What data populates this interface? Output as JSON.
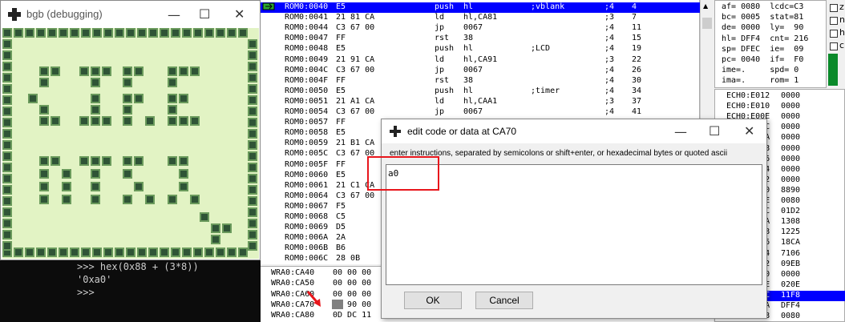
{
  "bgb": {
    "title": "bgb (debugging)",
    "minimize": "—",
    "maximize": "☐",
    "close": "✕"
  },
  "console": {
    "lines": [
      ">>> hex(0x88 + (3*8))",
      "'0xa0'",
      ">>>"
    ]
  },
  "disassembly": [
    {
      "addr": "ROM0:0040",
      "bytes": "E5",
      "mnem": "push",
      "ops": "hl",
      "comment": ";vblank",
      "cyc": ";4",
      "total": "4",
      "selected": true
    },
    {
      "addr": "ROM0:0041",
      "bytes": "21 81 CA",
      "mnem": "ld",
      "ops": "hl,CA81",
      "comment": "",
      "cyc": ";3",
      "total": "7"
    },
    {
      "addr": "ROM0:0044",
      "bytes": "C3 67 00",
      "mnem": "jp",
      "ops": "0067",
      "comment": "",
      "cyc": ";4",
      "total": "11"
    },
    {
      "addr": "ROM0:0047",
      "bytes": "FF",
      "mnem": "rst",
      "ops": "38",
      "comment": "",
      "cyc": ";4",
      "total": "15"
    },
    {
      "addr": "ROM0:0048",
      "bytes": "E5",
      "mnem": "push",
      "ops": "hl",
      "comment": ";LCD",
      "cyc": ";4",
      "total": "19"
    },
    {
      "addr": "ROM0:0049",
      "bytes": "21 91 CA",
      "mnem": "ld",
      "ops": "hl,CA91",
      "comment": "",
      "cyc": ";3",
      "total": "22"
    },
    {
      "addr": "ROM0:004C",
      "bytes": "C3 67 00",
      "mnem": "jp",
      "ops": "0067",
      "comment": "",
      "cyc": ";4",
      "total": "26"
    },
    {
      "addr": "ROM0:004F",
      "bytes": "FF",
      "mnem": "rst",
      "ops": "38",
      "comment": "",
      "cyc": ";4",
      "total": "30"
    },
    {
      "addr": "ROM0:0050",
      "bytes": "E5",
      "mnem": "push",
      "ops": "hl",
      "comment": ";timer",
      "cyc": ";4",
      "total": "34"
    },
    {
      "addr": "ROM0:0051",
      "bytes": "21 A1 CA",
      "mnem": "ld",
      "ops": "hl,CAA1",
      "comment": "",
      "cyc": ";3",
      "total": "37"
    },
    {
      "addr": "ROM0:0054",
      "bytes": "C3 67 00",
      "mnem": "jp",
      "ops": "0067",
      "comment": "",
      "cyc": ";4",
      "total": "41"
    },
    {
      "addr": "ROM0:0057",
      "bytes": "FF",
      "mnem": "",
      "ops": "",
      "comment": "",
      "cyc": "",
      "total": ""
    },
    {
      "addr": "ROM0:0058",
      "bytes": "E5",
      "mnem": "",
      "ops": "",
      "comment": "",
      "cyc": "",
      "total": ""
    },
    {
      "addr": "ROM0:0059",
      "bytes": "21 B1 CA",
      "mnem": "",
      "ops": "",
      "comment": "",
      "cyc": "",
      "total": ""
    },
    {
      "addr": "ROM0:005C",
      "bytes": "C3 67 00",
      "mnem": "",
      "ops": "",
      "comment": "",
      "cyc": "",
      "total": ""
    },
    {
      "addr": "ROM0:005F",
      "bytes": "FF",
      "mnem": "",
      "ops": "",
      "comment": "",
      "cyc": "",
      "total": ""
    },
    {
      "addr": "ROM0:0060",
      "bytes": "E5",
      "mnem": "",
      "ops": "",
      "comment": "",
      "cyc": "",
      "total": ""
    },
    {
      "addr": "ROM0:0061",
      "bytes": "21 C1 CA",
      "mnem": "",
      "ops": "",
      "comment": "",
      "cyc": "",
      "total": ""
    },
    {
      "addr": "ROM0:0064",
      "bytes": "C3 67 00",
      "mnem": "",
      "ops": "",
      "comment": "",
      "cyc": "",
      "total": ""
    },
    {
      "addr": "ROM0:0067",
      "bytes": "F5",
      "mnem": "",
      "ops": "",
      "comment": "",
      "cyc": "",
      "total": ""
    },
    {
      "addr": "ROM0:0068",
      "bytes": "C5",
      "mnem": "",
      "ops": "",
      "comment": "",
      "cyc": "",
      "total": ""
    },
    {
      "addr": "ROM0:0069",
      "bytes": "D5",
      "mnem": "",
      "ops": "",
      "comment": "",
      "cyc": "",
      "total": ""
    },
    {
      "addr": "ROM0:006A",
      "bytes": "2A",
      "mnem": "",
      "ops": "",
      "comment": "",
      "cyc": "",
      "total": ""
    },
    {
      "addr": "ROM0:006B",
      "bytes": "B6",
      "mnem": "",
      "ops": "",
      "comment": "",
      "cyc": "",
      "total": ""
    },
    {
      "addr": "ROM0:006C",
      "bytes": "28 0B",
      "mnem": "",
      "ops": "",
      "comment": "",
      "cyc": "",
      "total": ""
    }
  ],
  "registers": [
    "af= 0080  lcdc=C3",
    "bc= 0005  stat=81",
    "de= 0000  ly=  90",
    "hl= DFF4  cnt= 216",
    "sp= DFEC  ie=  09",
    "pc= 0040  if=  F0",
    "ime=.     spd= 0",
    "ima=.     rom= 1"
  ],
  "flags": [
    "z",
    "n",
    "h",
    "c"
  ],
  "stack": [
    {
      "addr": "ECH0:E012",
      "val": "0000"
    },
    {
      "addr": "ECH0:E010",
      "val": "0000"
    },
    {
      "addr": "ECH0:E00E",
      "val": "0000"
    },
    {
      "addr": "ECH0:E00C",
      "val": "0000"
    },
    {
      "addr": "ECH0:E00A",
      "val": "0000"
    },
    {
      "addr": "ECH0:E008",
      "val": "0000"
    },
    {
      "addr": "ECH0:E006",
      "val": "0000"
    },
    {
      "addr": "ECH0:E004",
      "val": "0000"
    },
    {
      "addr": "ECH0:E002",
      "val": "0000"
    },
    {
      "addr": "ECH0:E000",
      "val": "8890"
    },
    {
      "addr": "WRA1:DFFE",
      "val": "0080"
    },
    {
      "addr": "WRA1:DFFC",
      "val": "01D2"
    },
    {
      "addr": "WRA1:DFFA",
      "val": "1308"
    },
    {
      "addr": "WRA1:DFF8",
      "val": "1225"
    },
    {
      "addr": "WRA1:DFF6",
      "val": "18CA"
    },
    {
      "addr": "WRA1:DFF4",
      "val": "7106"
    },
    {
      "addr": "WRA1:DFF2",
      "val": "09EB"
    },
    {
      "addr": "WRA1:DFF0",
      "val": "0000"
    },
    {
      "addr": "WRA1:DFEE",
      "val": "020E"
    },
    {
      "addr": "WRA1:DFEC",
      "val": "11F8",
      "selected": true
    },
    {
      "addr": "WRA1:DFEA",
      "val": "DFF4"
    },
    {
      "addr": "WRA1:DFE8",
      "val": "0080"
    }
  ],
  "memory": [
    {
      "addr": "WRA0:CA40",
      "bytes": "00 00 00"
    },
    {
      "addr": "WRA0:CA50",
      "bytes": "00 00 00"
    },
    {
      "addr": "WRA0:CA60",
      "bytes": "00 00 00"
    },
    {
      "addr": "WRA0:CA70",
      "bytes": "88 90 00"
    },
    {
      "addr": "WRA0:CA80",
      "bytes": "0D DC 11"
    }
  ],
  "dialog": {
    "title": "edit code or data at CA70",
    "hint": "enter instructions, separated by semicolons or shift+enter, or hexadecimal bytes or quoted ascii",
    "input_value": "a0",
    "ok": "OK",
    "cancel": "Cancel",
    "maximize": "☐",
    "close": "✕",
    "minimize": "—"
  },
  "colors": {
    "selection": "#0000ff",
    "annotation": "#e8161c",
    "gb_light": "#e2f3c4",
    "gb_dark": "#2f5436"
  }
}
